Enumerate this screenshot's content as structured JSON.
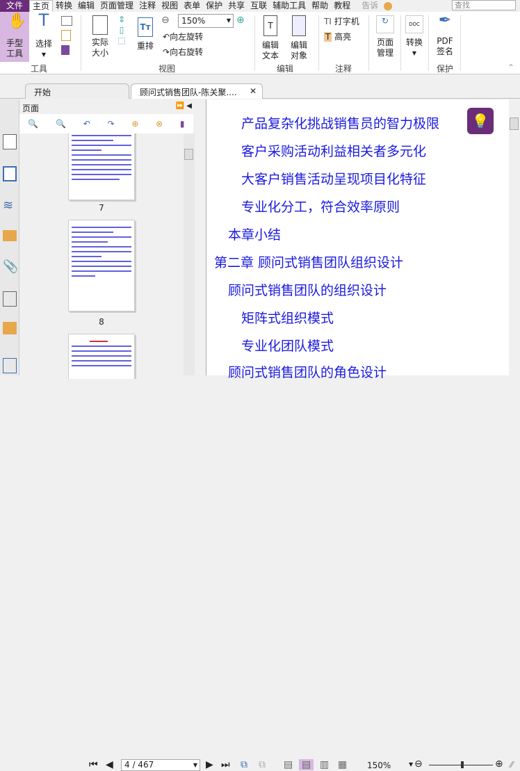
{
  "menu": {
    "file": "文件",
    "items": [
      "主页",
      "转换",
      "编辑",
      "页面管理",
      "注释",
      "视图",
      "表单",
      "保护",
      "共享",
      "互联",
      "辅助工具",
      "帮助",
      "教程"
    ],
    "tell": "告诉",
    "search_placeholder": "查找"
  },
  "ribbon": {
    "hand": "手型工具",
    "select": "选择",
    "actual_size": "实际大小",
    "reflow": "重排",
    "zoom_value": "150%",
    "rotate_left": "向左旋转",
    "rotate_right": "向右旋转",
    "edit_text": "编辑文本",
    "edit_object": "编辑对象",
    "typewriter": "打字机",
    "highlight": "高亮",
    "page_manage": "页面管理",
    "convert": "转换",
    "pdf_sign": "PDF签名",
    "groups": {
      "tools": "工具",
      "view": "视图",
      "edit": "编辑",
      "comment": "注释",
      "protect": "保护"
    }
  },
  "tabs": [
    {
      "label": "开始"
    },
    {
      "label": "顾问式销售团队-陈关聚...."
    }
  ],
  "panel": {
    "title": "页面",
    "pages": [
      "7",
      "8"
    ]
  },
  "content": {
    "lines": [
      "产品复杂化挑战销售员的智力极限",
      "客户采购活动利益相关者多元化",
      "大客户销售活动呈现项目化特征",
      "专业化分工，符合效率原则",
      "本章小结",
      "第二章 顾问式销售团队组织设计",
      "顾问式销售团队的组织设计",
      "矩阵式组织模式",
      "专业化团队模式",
      "顾问式销售团队的角色设计"
    ]
  },
  "status": {
    "page": "4 / 467",
    "zoom": "150%",
    "zoom_fraction": 0.52
  }
}
